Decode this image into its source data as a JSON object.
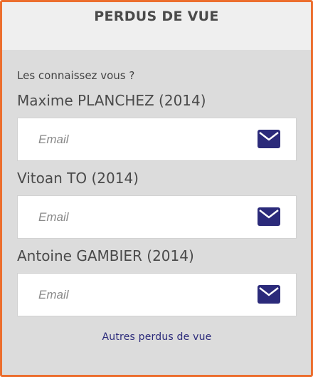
{
  "header": {
    "title": "PERDUS DE VUE"
  },
  "intro": "Les connaissez vous ?",
  "contacts": [
    {
      "name": "Maxime PLANCHEZ (2014)",
      "email_placeholder": "Email"
    },
    {
      "name": "Vitoan TO (2014)",
      "email_placeholder": "Email"
    },
    {
      "name": "Antoine GAMBIER (2014)",
      "email_placeholder": "Email"
    }
  ],
  "footer": {
    "link_label": "Autres perdus de vue"
  },
  "icons": {
    "send": "envelope-icon"
  },
  "colors": {
    "border": "#ec6e2e",
    "accent": "#2b2a7a",
    "panel": "#dcdcdc",
    "header_bg": "#efefef"
  }
}
